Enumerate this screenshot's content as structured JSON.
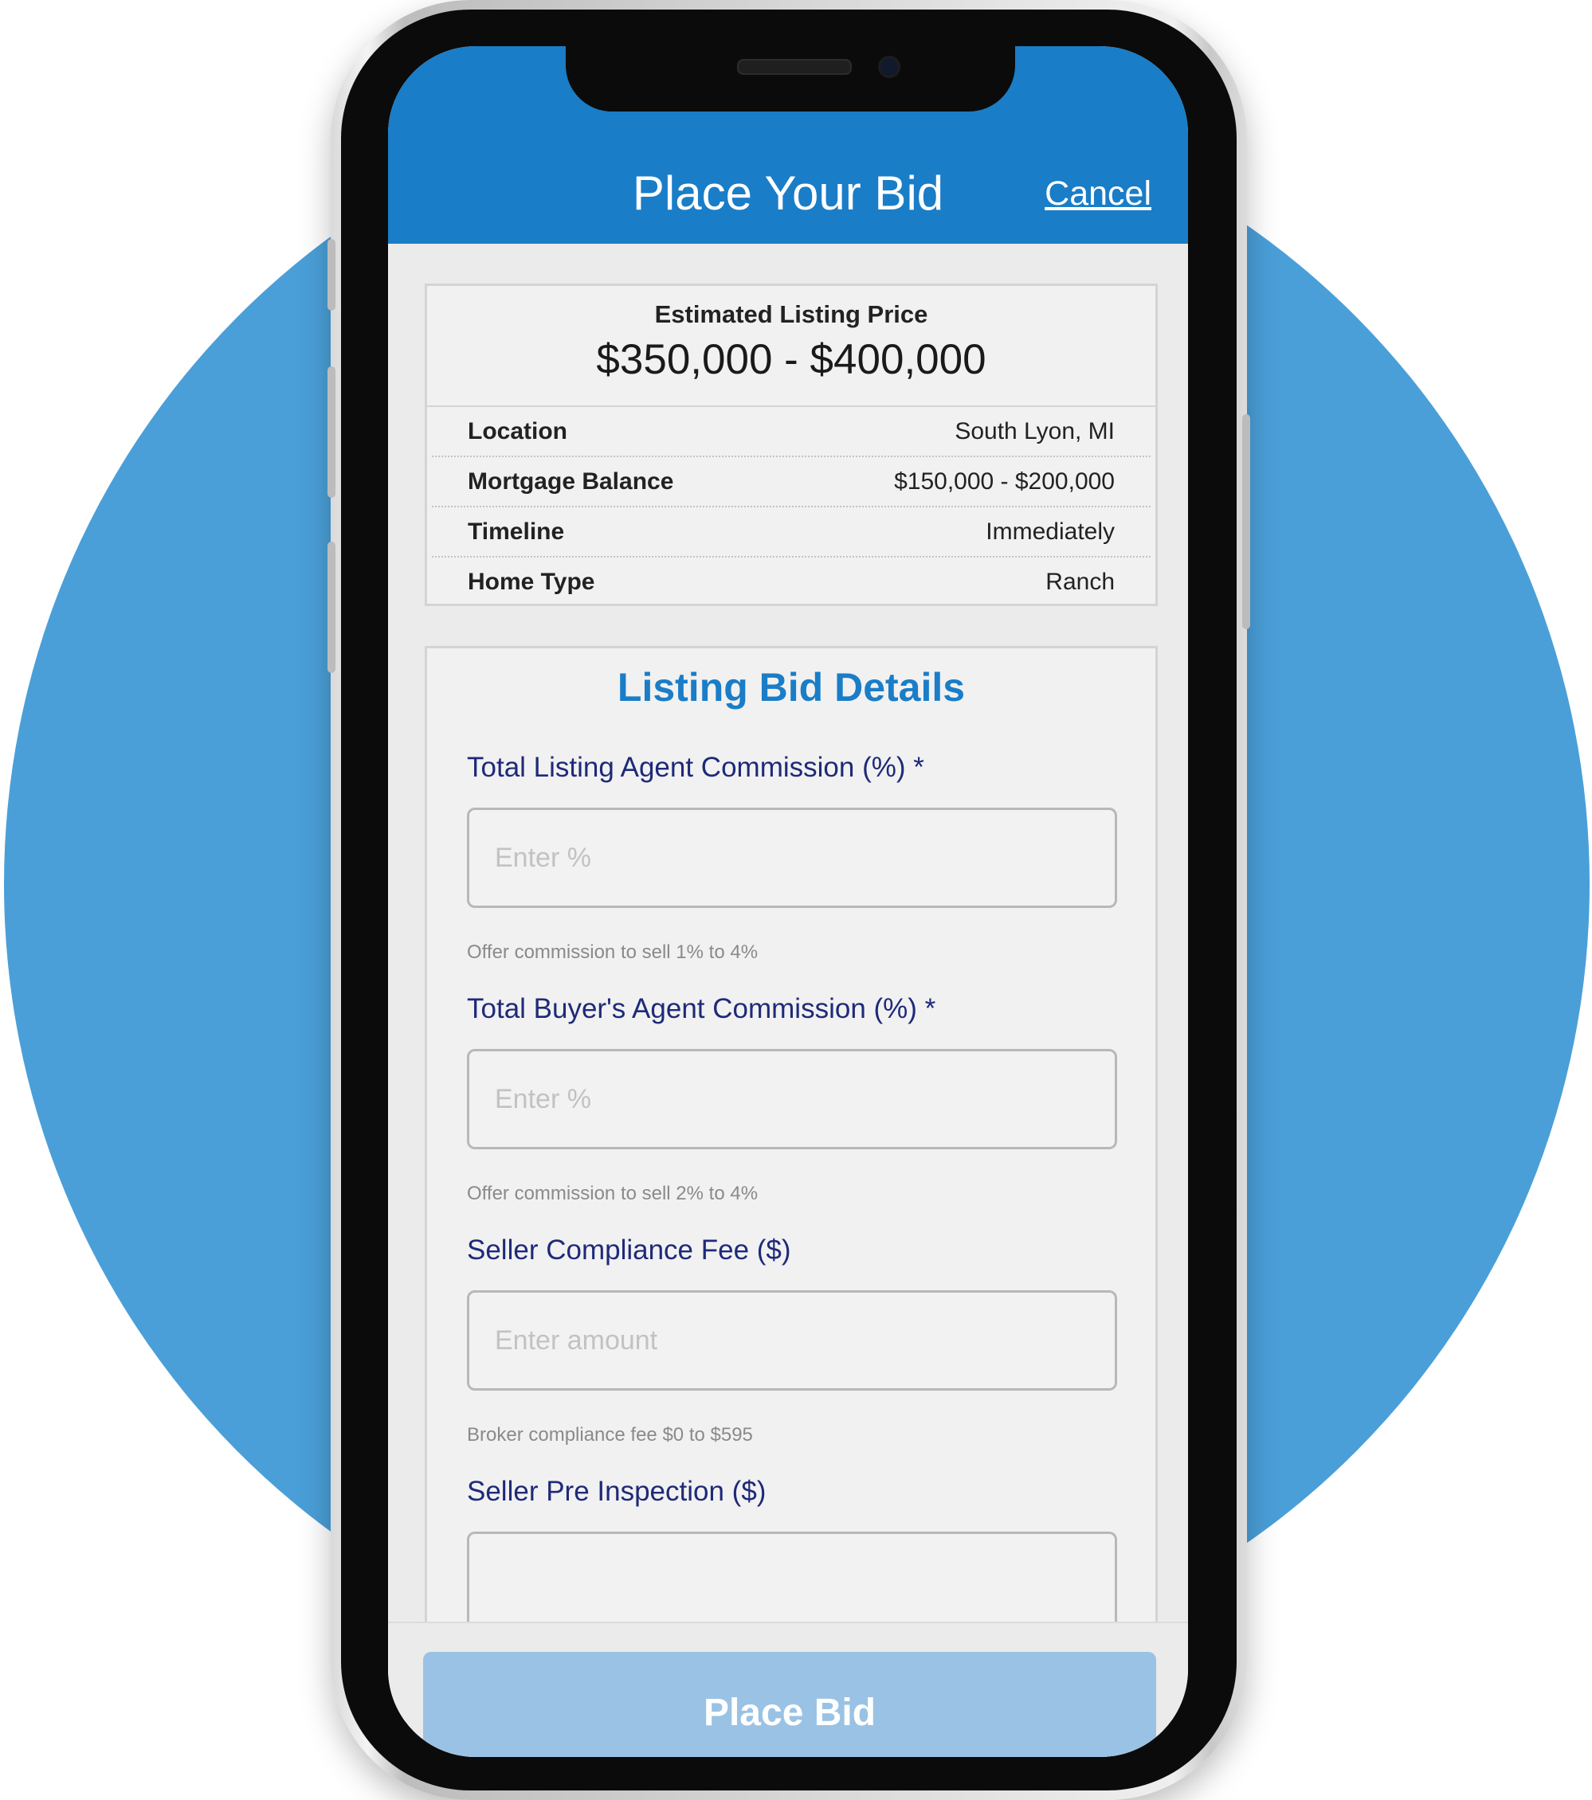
{
  "header": {
    "title": "Place Your Bid",
    "cancel_label": "Cancel"
  },
  "summary": {
    "estimate_label": "Estimated Listing Price",
    "estimate_value": "$350,000 - $400,000",
    "rows": [
      {
        "label": "Location",
        "value": "South Lyon, MI"
      },
      {
        "label": "Mortgage Balance",
        "value": "$150,000 - $200,000"
      },
      {
        "label": "Timeline",
        "value": "Immediately"
      },
      {
        "label": "Home Type",
        "value": "Ranch"
      }
    ]
  },
  "bid_details": {
    "title": "Listing Bid Details",
    "fields": [
      {
        "label": "Total Listing Agent Commission (%) *",
        "placeholder": "Enter %",
        "value": "",
        "help": "Offer commission to sell 1% to 4%"
      },
      {
        "label": "Total Buyer's Agent Commission (%) *",
        "placeholder": "Enter %",
        "value": "",
        "help": "Offer commission to sell 2% to 4%"
      },
      {
        "label": "Seller Compliance Fee ($)",
        "placeholder": "Enter amount",
        "value": "",
        "help": "Broker compliance fee $0 to $595"
      },
      {
        "label": "Seller Pre Inspection ($)",
        "placeholder": "",
        "value": "",
        "help": ""
      }
    ]
  },
  "footer": {
    "place_bid_label": "Place Bid"
  },
  "colors": {
    "brand_blue": "#1a7dc7",
    "background_circle": "#4a9fd8",
    "label_navy": "#1e2a78",
    "disabled_button": "#9ac2e4"
  },
  "icons": [
    "camera-icon",
    "speaker-icon"
  ]
}
